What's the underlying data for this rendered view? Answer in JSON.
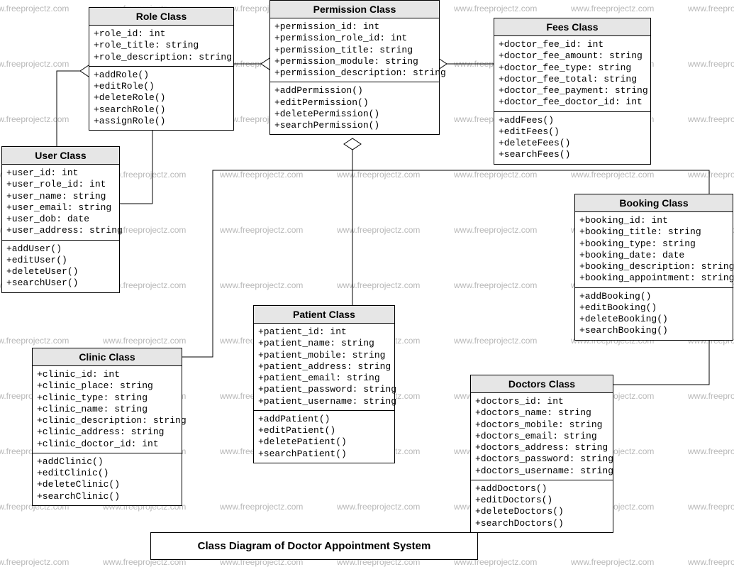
{
  "watermark": "www.freeprojectz.com",
  "title": "Class Diagram of Doctor Appointment System",
  "classes": {
    "role": {
      "name": "Role Class",
      "attrs": [
        "+role_id: int",
        "+role_title: string",
        "+role_description: string"
      ],
      "ops": [
        "+addRole()",
        "+editRole()",
        "+deleteRole()",
        "+searchRole()",
        "+assignRole()"
      ]
    },
    "permission": {
      "name": "Permission Class",
      "attrs": [
        "+permission_id: int",
        "+permission_role_id: int",
        "+permission_title: string",
        "+permission_module: string",
        "+permission_description: string"
      ],
      "ops": [
        "+addPermission()",
        "+editPermission()",
        "+deletePermission()",
        "+searchPermission()"
      ]
    },
    "fees": {
      "name": "Fees Class",
      "attrs": [
        "+doctor_fee_id: int",
        "+doctor_fee_amount: string",
        "+doctor_fee_type: string",
        "+doctor_fee_total: string",
        "+doctor_fee_payment: string",
        "+doctor_fee_doctor_id: int"
      ],
      "ops": [
        "+addFees()",
        "+editFees()",
        "+deleteFees()",
        "+searchFees()"
      ]
    },
    "user": {
      "name": "User Class",
      "attrs": [
        "+user_id: int",
        "+user_role_id: int",
        "+user_name: string",
        "+user_email: string",
        "+user_dob: date",
        "+user_address: string"
      ],
      "ops": [
        "+addUser()",
        "+editUser()",
        "+deleteUser()",
        "+searchUser()"
      ]
    },
    "booking": {
      "name": "Booking Class",
      "attrs": [
        "+booking_id: int",
        "+booking_title: string",
        "+booking_type: string",
        "+booking_date: date",
        "+booking_description: string",
        "+booking_appointment: string"
      ],
      "ops": [
        "+addBooking()",
        "+editBooking()",
        "+deleteBooking()",
        "+searchBooking()"
      ]
    },
    "patient": {
      "name": "Patient Class",
      "attrs": [
        "+patient_id: int",
        "+patient_name: string",
        "+patient_mobile: string",
        "+patient_address: string",
        "+patient_email: string",
        "+patient_password: string",
        "+patient_username: string"
      ],
      "ops": [
        "+addPatient()",
        "+editPatient()",
        "+deletePatient()",
        "+searchPatient()"
      ]
    },
    "clinic": {
      "name": "Clinic Class",
      "attrs": [
        "+clinic_id: int",
        "+clinic_place: string",
        "+clinic_type: string",
        "+clinic_name: string",
        "+clinic_description: string",
        "+clinic_address: string",
        "+clinic_doctor_id: int"
      ],
      "ops": [
        "+addClinic()",
        "+editClinic()",
        "+deleteClinic()",
        "+searchClinic()"
      ]
    },
    "doctors": {
      "name": "Doctors Class",
      "attrs": [
        "+doctors_id: int",
        "+doctors_name: string",
        "+doctors_mobile: string",
        "+doctors_email: string",
        "+doctors_address: string",
        "+doctors_password: string",
        "+doctors_username: string"
      ],
      "ops": [
        "+addDoctors()",
        "+editDoctors()",
        "+deleteDoctors()",
        "+searchDoctors()"
      ]
    }
  }
}
